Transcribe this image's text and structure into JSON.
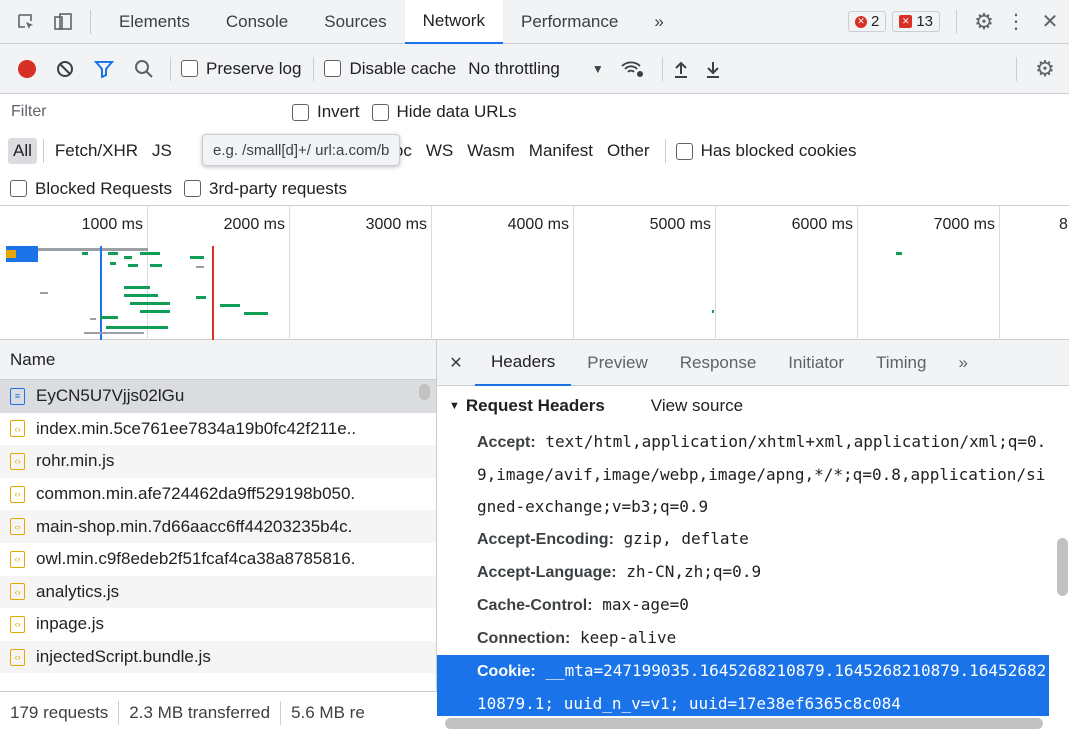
{
  "tabs": [
    "Elements",
    "Console",
    "Sources",
    "Network",
    "Performance"
  ],
  "more_tabs": "»",
  "errors": "2",
  "issues": "13",
  "toolbar": {
    "preserve_log": "Preserve log",
    "disable_cache": "Disable cache",
    "throttling": "No throttling"
  },
  "filter": {
    "placeholder": "Filter",
    "invert": "Invert",
    "hide_data_urls": "Hide data URLs",
    "tooltip": "e.g. /small[d]+/ url:a.com/b"
  },
  "types": [
    "All",
    "Fetch/XHR",
    "JS",
    "oc",
    "WS",
    "Wasm",
    "Manifest",
    "Other"
  ],
  "has_blocked_cookies": "Has blocked cookies",
  "blocked_requests": "Blocked Requests",
  "third_party": "3rd-party requests",
  "timeline_ticks": [
    "1000 ms",
    "2000 ms",
    "3000 ms",
    "4000 ms",
    "5000 ms",
    "6000 ms",
    "7000 ms",
    "8"
  ],
  "name_header": "Name",
  "requests": [
    "EyCN5U7Vjjs02lGu",
    "index.min.5ce761ee7834a19b0fc42f211e..",
    "rohr.min.js",
    "common.min.afe724462da9ff529198b050.",
    "main-shop.min.7d66aacc6ff44203235b4c.",
    "owl.min.c9f8edeb2f51fcaf4ca38a8785816.",
    "analytics.js",
    "inpage.js",
    "injectedScript.bundle.js"
  ],
  "status": {
    "requests": "179 requests",
    "transferred": "2.3 MB transferred",
    "resources": "5.6 MB re"
  },
  "detail_tabs": [
    "Headers",
    "Preview",
    "Response",
    "Initiator",
    "Timing"
  ],
  "detail_more": "»",
  "request_headers": {
    "title": "Request Headers",
    "view_source": "View source",
    "items": [
      {
        "name": "Accept:",
        "value": "text/html,application/xhtml+xml,application/xml;q=0.9,image/avif,image/webp,image/apng,*/*;q=0.8,application/signed-exchange;v=b3;q=0.9"
      },
      {
        "name": "Accept-Encoding:",
        "value": "gzip, deflate"
      },
      {
        "name": "Accept-Language:",
        "value": "zh-CN,zh;q=0.9"
      },
      {
        "name": "Cache-Control:",
        "value": "max-age=0"
      },
      {
        "name": "Connection:",
        "value": "keep-alive"
      },
      {
        "name": "Cookie:",
        "value": "__mta=247199035.1645268210879.1645268210879.1645268210879.1; uuid_n_v=v1; uuid=17e38ef6365c8c084"
      }
    ]
  }
}
